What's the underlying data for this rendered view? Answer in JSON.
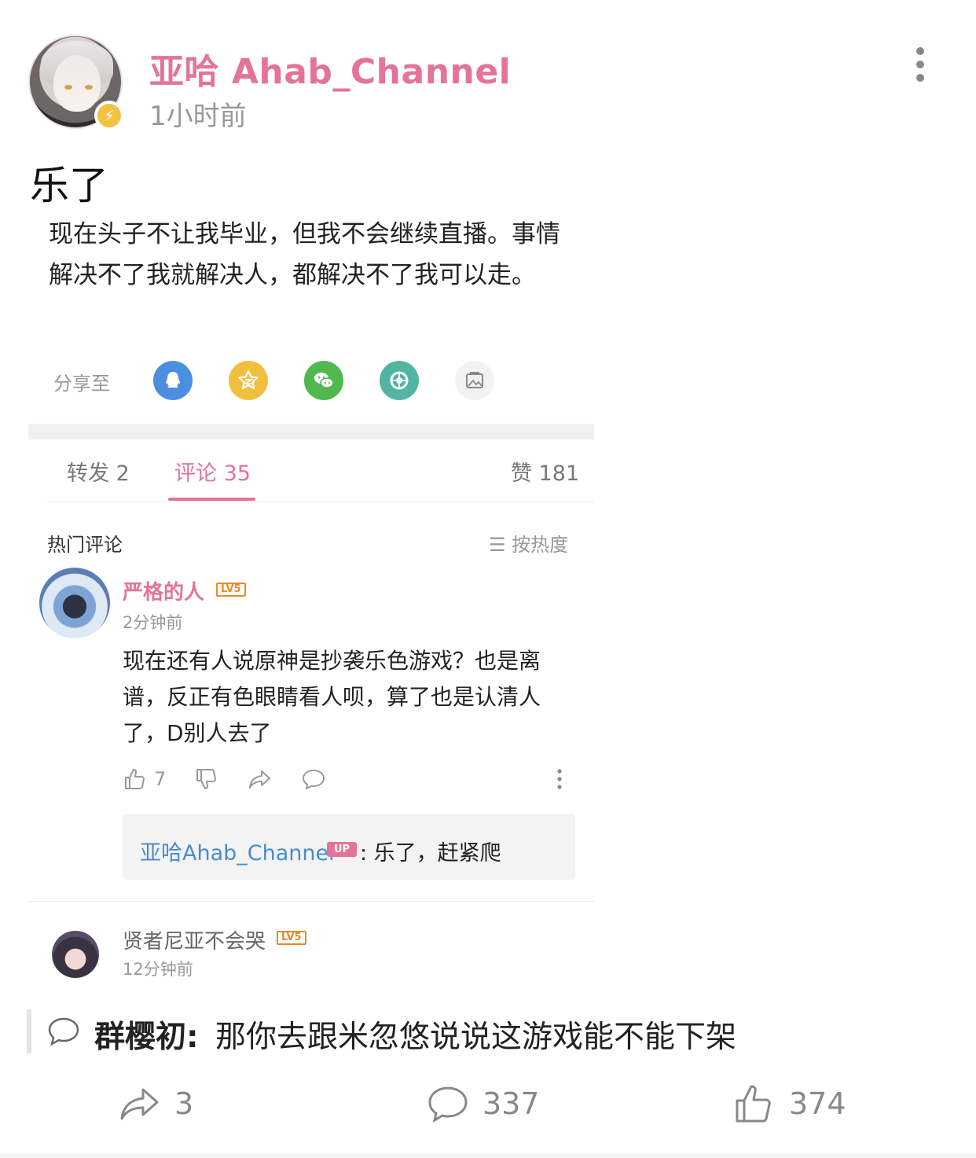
{
  "post": {
    "author": "亚哈 Ahab_Channel",
    "time": "1小时前",
    "title": "乐了",
    "body": "现在头子不让我毕业，但我不会继续直播。事情解决不了我就解决人，都解决不了我可以走。"
  },
  "share": {
    "label": "分享至",
    "targets": [
      {
        "icon": "qq-icon",
        "color": "#4c8fe0"
      },
      {
        "icon": "qzone-icon",
        "color": "#f0bf3d"
      },
      {
        "icon": "wechat-icon",
        "color": "#4fb94f"
      },
      {
        "icon": "moments-icon",
        "color": "#52b5a3"
      },
      {
        "icon": "image-share-icon",
        "color": "#f2f2f2"
      }
    ]
  },
  "tabs": {
    "repost": "转发 2",
    "comments": "评论 35",
    "likes": "赞 181"
  },
  "comments_header": {
    "title": "热门评论",
    "sort": "按热度"
  },
  "comments": [
    {
      "user": "严格的人",
      "level": "LV5",
      "time": "2分钟前",
      "text": "现在还有人说原神是抄袭乐色游戏？也是离谱，反正有色眼睛看人呗，算了也是认清人了，D别人去了",
      "likes": "7",
      "reply": {
        "user": "亚哈Ahab_Channel",
        "badge": "UP",
        "text": ": 乐了，赶紧爬"
      }
    },
    {
      "user": "贤者尼亚不会哭",
      "level": "LV5",
      "time": "12分钟前"
    }
  ],
  "quote": {
    "name": "群樱初:",
    "text": "那你去跟米忽悠说说这游戏能不能下架"
  },
  "bottom_bar": {
    "shares": "3",
    "comments": "337",
    "likes": "374"
  },
  "colors": {
    "accent": "#e4739a",
    "link": "#4a8bcf",
    "level_badge": "#e58b2c"
  }
}
